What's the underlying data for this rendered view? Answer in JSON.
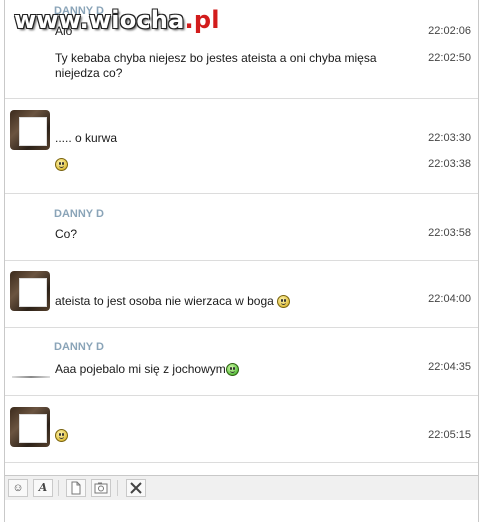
{
  "watermark": {
    "text": "www.wiocha",
    "dot": ".pl"
  },
  "messages": [
    {
      "name": "DANNY D",
      "lines": [
        {
          "text": "Alo",
          "time": "22:02:06"
        },
        {
          "text": "Ty kebaba chyba niejesz bo jestes ateista a oni chyba mięsa niejedza co?",
          "time": "22:02:50"
        }
      ]
    },
    {
      "lines": [
        {
          "text": "..... o kurwa",
          "time": "22:03:30"
        },
        {
          "emoticon": "smiley-icon",
          "time": "22:03:38"
        }
      ]
    },
    {
      "name": "DANNY D",
      "lines": [
        {
          "text": "Co?",
          "time": "22:03:58"
        }
      ]
    },
    {
      "lines": [
        {
          "text": "ateista to jest osoba nie wierzaca w boga",
          "emoticon": "grin-icon",
          "time": "22:04:00"
        }
      ]
    },
    {
      "name": "DANNY D",
      "lines": [
        {
          "text": "Aaa pojebalo mi się z jochowym",
          "emoticon": "green-smiley-icon",
          "time": "22:04:35"
        }
      ]
    },
    {
      "lines": [
        {
          "emoticon": "smiley-icon",
          "time": "22:05:15"
        }
      ]
    }
  ],
  "toolbar": {
    "icons": [
      "emoticon-icon",
      "font-icon",
      "file-icon",
      "photo-icon",
      "tools-icon"
    ],
    "font_label": "A"
  },
  "colors": {
    "name": "#8aa4b8",
    "separator": "#dcdcdc",
    "watermark_dot": "#d21c1c"
  }
}
